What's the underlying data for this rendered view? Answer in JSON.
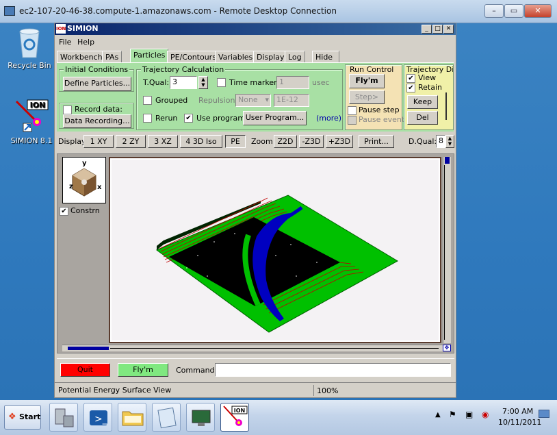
{
  "rdp": {
    "title": "ec2-107-20-46-38.compute-1.amazonaws.com - Remote Desktop Connection",
    "min": "–",
    "max": "▭",
    "close": "✕"
  },
  "desktop": {
    "icons": [
      {
        "label": "Recycle Bin",
        "icon": "recycle-bin-icon"
      },
      {
        "label": "SIMION 8.1",
        "icon": "simion-shortcut-icon"
      }
    ]
  },
  "simion": {
    "title": "SIMION",
    "logo": "ION",
    "menu": [
      "File",
      "Help"
    ],
    "tabs": [
      "Workbench",
      "PAs",
      "Particles",
      "PE/Contours",
      "Variables",
      "Display",
      "Log",
      "Hide"
    ],
    "active_tab": "Particles",
    "initial": {
      "label": "Initial Conditions",
      "define": "Define Particles...",
      "record_label": "Record data:",
      "recording": "Data Recording..."
    },
    "traj": {
      "label": "Trajectory Calculation",
      "tqual_label": "T.Qual:",
      "tqual": "3",
      "time_markers": "Time markers:",
      "time_value": "1",
      "time_unit": "usec",
      "grouped": "Grouped",
      "repulsion": "Repulsion:",
      "repulsion_value": "None",
      "repulsion_amount": "1E-12",
      "rerun": "Rerun",
      "use_program": "Use program:",
      "user_program": "User Program...",
      "more": "(more)"
    },
    "run": {
      "label": "Run Control",
      "flym": "Fly'm",
      "step": "Step>",
      "pause_step": "Pause step",
      "pause_event": "Pause event"
    },
    "trajdisp": {
      "label": "Trajectory Dis",
      "view": "View",
      "retain": "Retain",
      "keep": "Keep",
      "del": "Del"
    },
    "display": {
      "label": "Display:",
      "xy": "1 XY",
      "zy": "2 ZY",
      "xz": "3 XZ",
      "iso": "4 3D Iso",
      "pe": "PE",
      "zoom": "Zoom:",
      "z2d": "Z2D",
      "mz3d": "-Z3D",
      "pz3d": "+Z3D",
      "print": "Print...",
      "dqual_label": "D.Qual:",
      "dqual": "8"
    },
    "axis": {
      "y": "y",
      "z": "z",
      "x": "x"
    },
    "constrain": "Constrn",
    "bottom": {
      "quit": "Quit",
      "flym": "Fly'm",
      "command": "Command:"
    },
    "status": {
      "text": "Potential Energy Surface View",
      "zoom": "100%"
    },
    "colors": {
      "panel": "#a8e0a4",
      "run_panel": "#f4e2b4",
      "trajdisp_panel": "#f0f0a8",
      "quit": "#ff0000",
      "flym": "#80e080",
      "surface": "#00c000",
      "beam": "#0000c0"
    }
  },
  "taskbar": {
    "start": "Start",
    "time": "7:00 AM",
    "date": "10/11/2011"
  }
}
